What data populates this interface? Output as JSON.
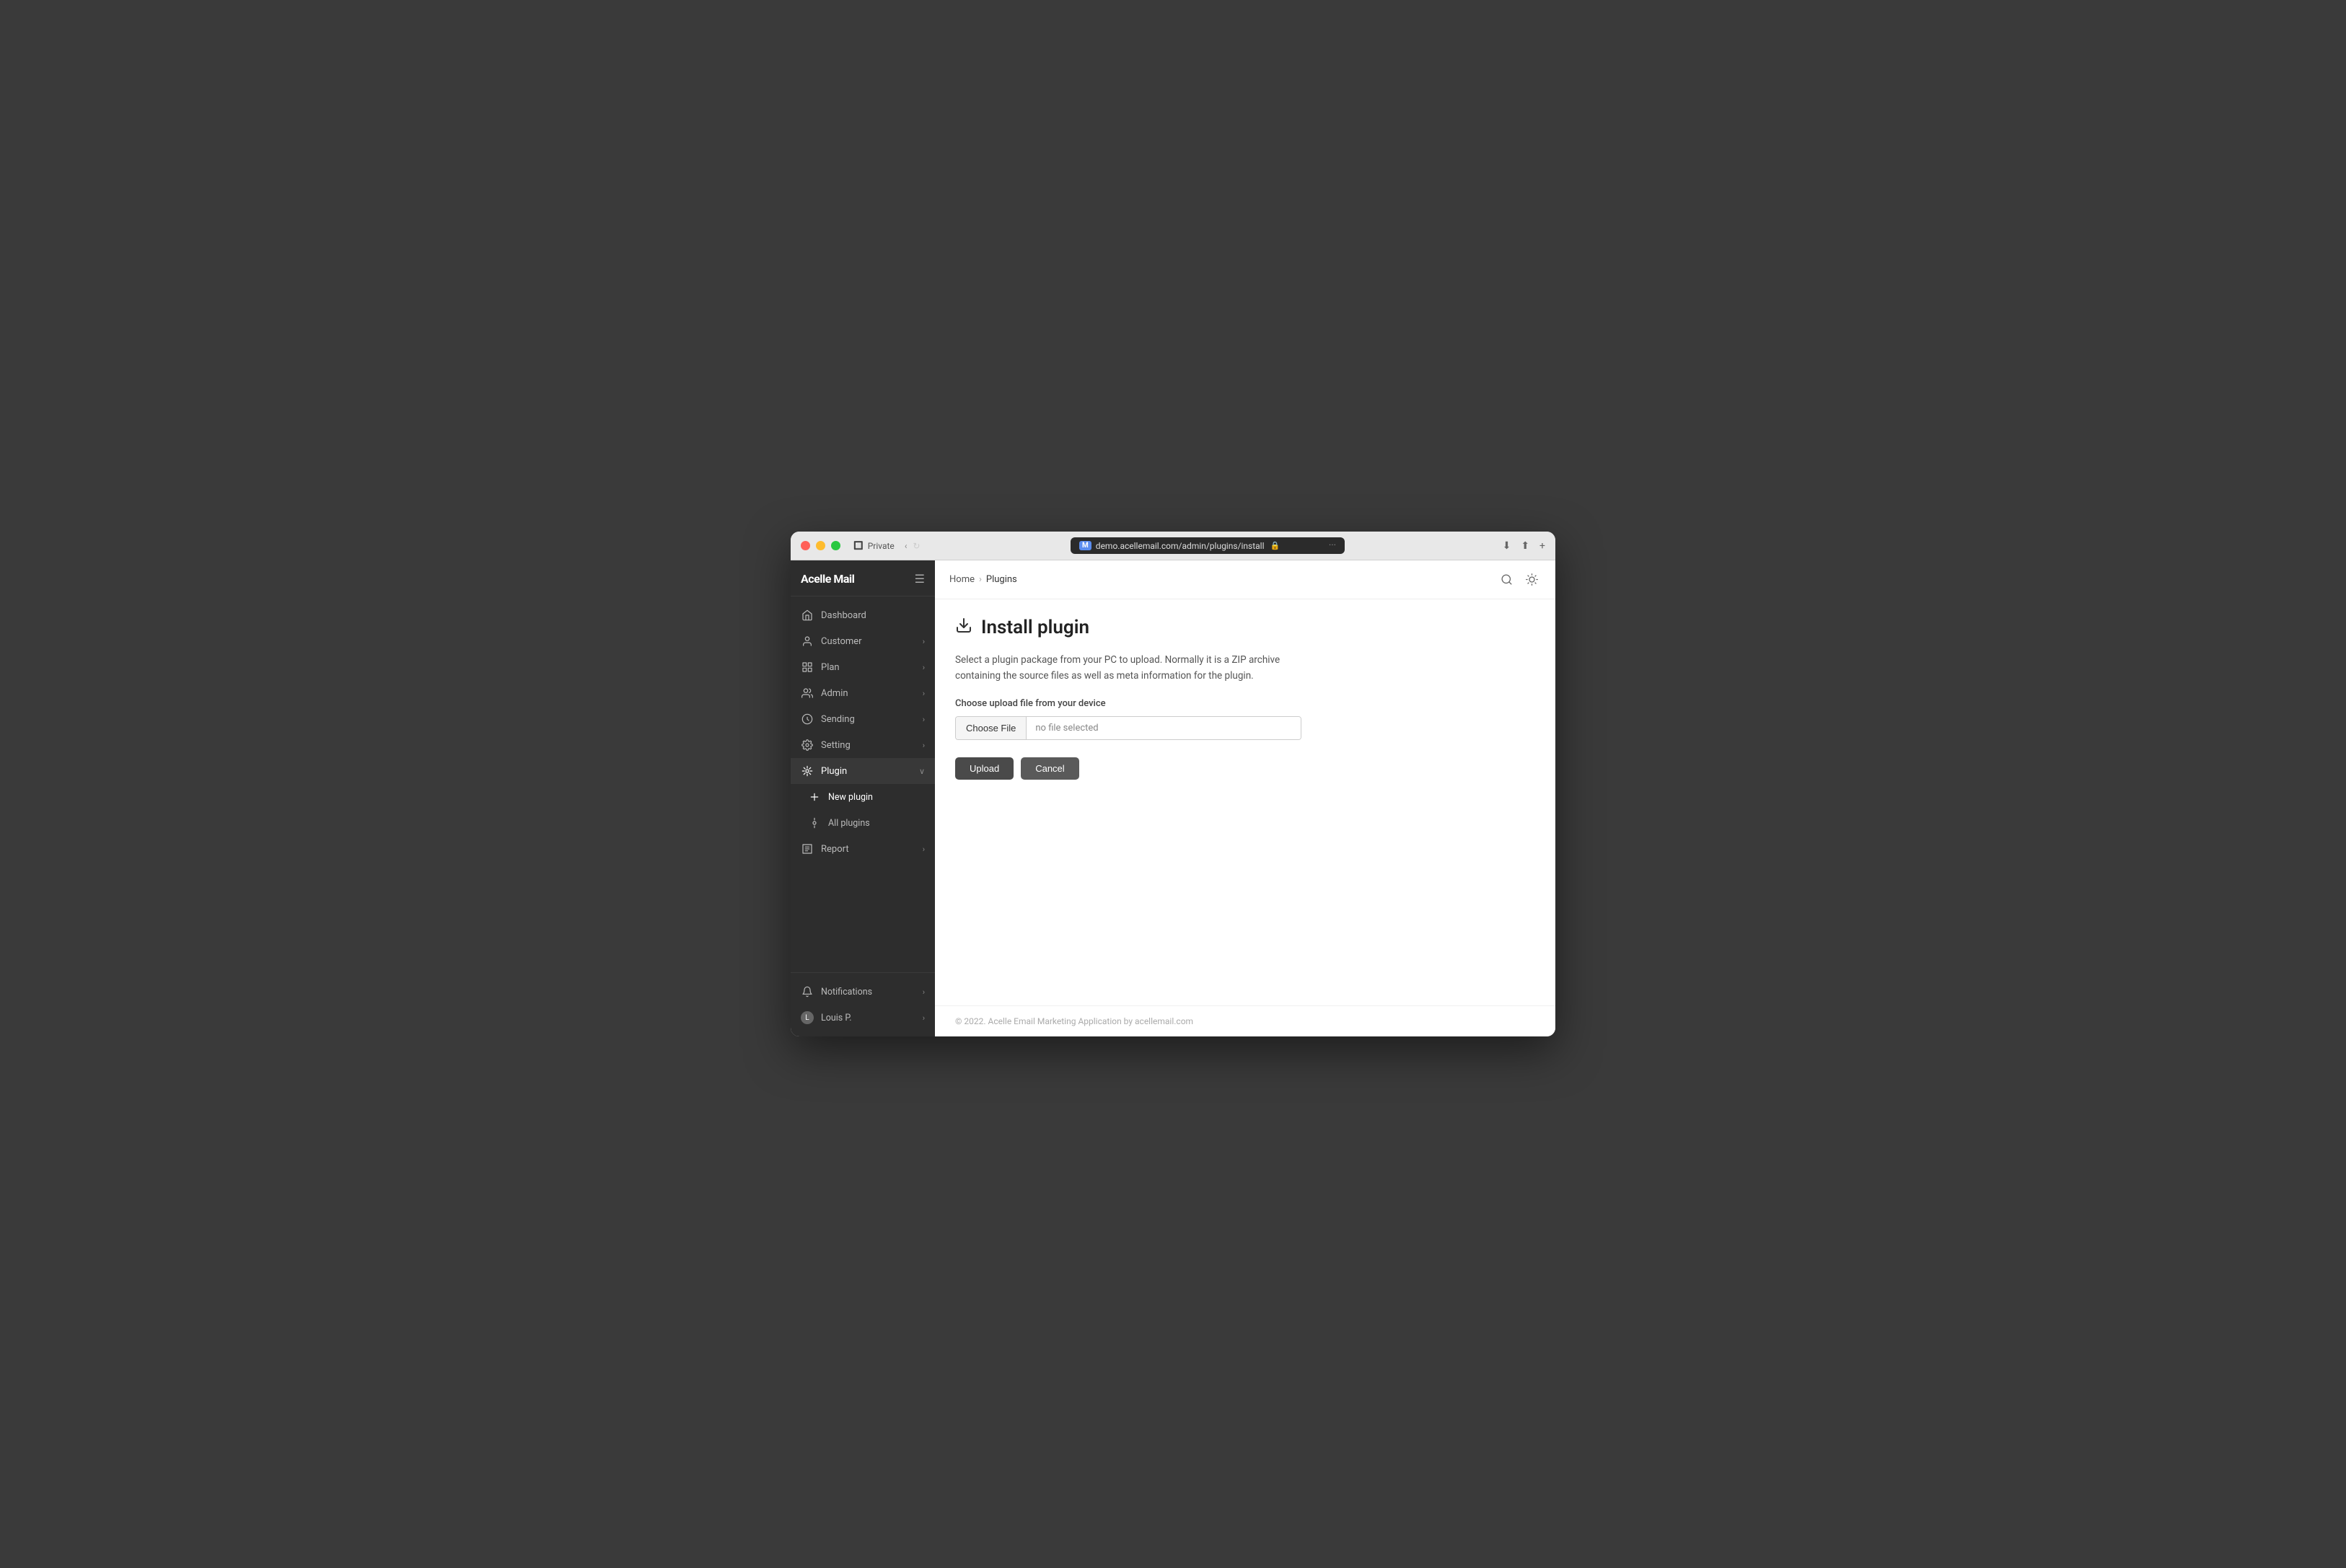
{
  "window": {
    "url": "demo.acellemail.com/admin/plugins/install",
    "tab_label": "Private"
  },
  "sidebar": {
    "logo": "Acelle Mail",
    "items": [
      {
        "id": "dashboard",
        "label": "Dashboard",
        "icon": "home",
        "has_chevron": false
      },
      {
        "id": "customer",
        "label": "Customer",
        "icon": "user",
        "has_chevron": true
      },
      {
        "id": "plan",
        "label": "Plan",
        "icon": "grid",
        "has_chevron": true
      },
      {
        "id": "admin",
        "label": "Admin",
        "icon": "users",
        "has_chevron": true
      },
      {
        "id": "sending",
        "label": "Sending",
        "icon": "send",
        "has_chevron": true
      },
      {
        "id": "setting",
        "label": "Setting",
        "icon": "settings",
        "has_chevron": true
      },
      {
        "id": "plugin",
        "label": "Plugin",
        "icon": "plugin",
        "has_chevron": true,
        "expanded": true
      },
      {
        "id": "new-plugin",
        "label": "New plugin",
        "icon": "plus",
        "sub": true,
        "active": true
      },
      {
        "id": "all-plugins",
        "label": "All plugins",
        "icon": "list",
        "sub": true
      },
      {
        "id": "report",
        "label": "Report",
        "icon": "report",
        "has_chevron": true
      }
    ],
    "footer": {
      "notifications_label": "Notifications",
      "user_label": "Louis P."
    }
  },
  "breadcrumb": {
    "home": "Home",
    "separator": "›",
    "current": "Plugins"
  },
  "page": {
    "title": "Install plugin",
    "description_line1": "Select a plugin package from your PC to upload. Normally it is a ZIP archive",
    "description_line2": "containing the source files as well as meta information for the plugin.",
    "upload_label": "Choose upload file from your device",
    "choose_file_btn": "Choose File",
    "no_file_text": "no file selected",
    "upload_btn": "Upload",
    "cancel_btn": "Cancel"
  },
  "footer": {
    "copyright": "© 2022. Acelle Email Marketing Application by acellemail.com"
  }
}
